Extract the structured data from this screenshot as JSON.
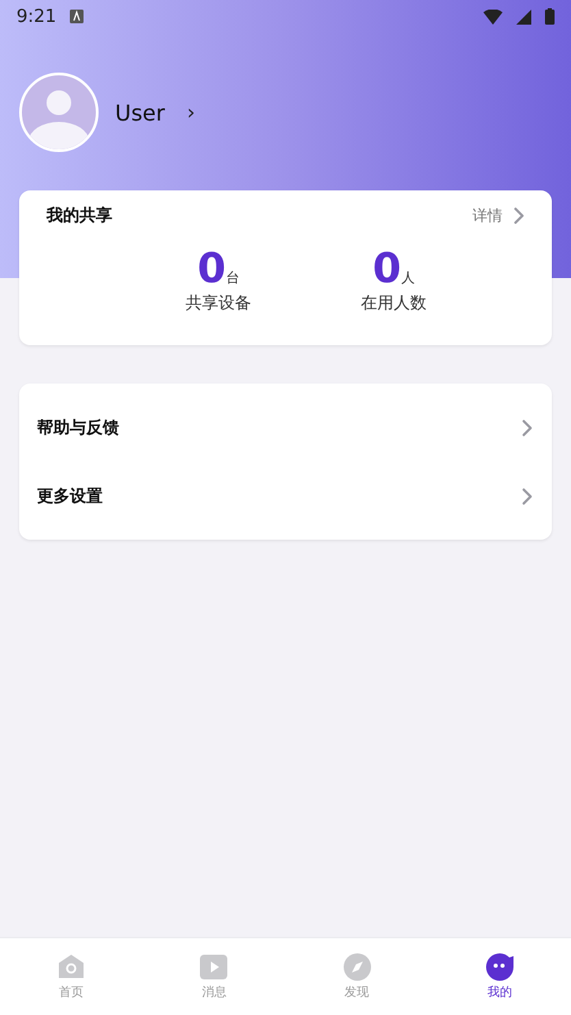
{
  "status_bar": {
    "time": "9:21"
  },
  "profile": {
    "name": "User",
    "chevron": "›"
  },
  "share_card": {
    "title": "我的共享",
    "link": "详情",
    "stats": [
      {
        "value": "0",
        "unit": "台",
        "label": "共享设备"
      },
      {
        "value": "0",
        "unit": "人",
        "label": "在用人数"
      }
    ]
  },
  "menu": [
    {
      "label": "帮助与反馈"
    },
    {
      "label": "更多设置"
    }
  ],
  "bottom_nav": [
    {
      "kind": "home",
      "label": "首页",
      "selected": false
    },
    {
      "kind": "play",
      "label": "消息",
      "selected": false
    },
    {
      "kind": "compass",
      "label": "发现",
      "selected": false
    },
    {
      "kind": "face",
      "label": "我的",
      "selected": true
    }
  ]
}
